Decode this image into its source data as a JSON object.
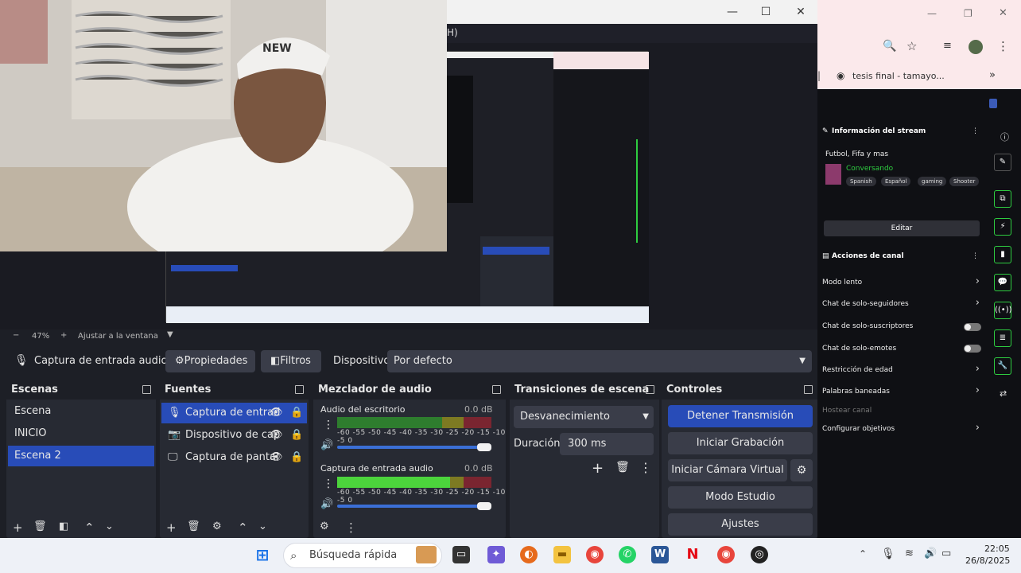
{
  "obs": {
    "title_fragment": "H)",
    "zoom": {
      "minus": "−",
      "percent": "47%",
      "plus": "+",
      "fit_label": "Ajustar a la ventana"
    },
    "source_bar": {
      "source_name": "Captura de entrada audio",
      "properties_label": "Propiedades",
      "filters_label": "Filtros",
      "device_label": "Dispositivo",
      "device_value": "Por defecto"
    },
    "scenes": {
      "title": "Escenas",
      "items": [
        "Escena",
        "INICIO",
        "Escena 2"
      ]
    },
    "sources": {
      "title": "Fuentes",
      "items": [
        "Captura de entrad",
        "Dispositivo de cap",
        "Captura de pantal"
      ]
    },
    "mixer": {
      "title": "Mezclador de audio",
      "channels": [
        {
          "name": "Audio del escritorio",
          "db": "0.0 dB",
          "level": 0
        },
        {
          "name": "Captura de entrada audio",
          "db": "0.0 dB",
          "level": 0.73
        }
      ],
      "ticks": "-60 -55 -50 -45 -40 -35 -30 -25 -20 -15 -10 -5  0"
    },
    "transitions": {
      "title": "Transiciones de escena",
      "type": "Desvanecimiento",
      "duration_label": "Duración",
      "duration_value": "300 ms"
    },
    "controls": {
      "title": "Controles",
      "stop_stream": "Detener Transmisión",
      "start_recording": "Iniciar Grabación",
      "virtual_cam": "Iniciar Cámara Virtual",
      "studio_mode": "Modo Estudio",
      "settings": "Ajustes"
    }
  },
  "chrome": {
    "bookmark": "tesis final - tamayo...",
    "stream_info_title": "Información del stream",
    "stream_title": "Futbol, Fifa y mas",
    "category": "Conversando",
    "tags": [
      "Spanish",
      "Español",
      "gaming",
      "Shooter"
    ],
    "edit_label": "Editar",
    "channel_actions_title": "Acciones de canal",
    "actions": [
      {
        "label": "Modo lento",
        "control": "chevron"
      },
      {
        "label": "Chat de solo-seguidores",
        "control": "chevron"
      },
      {
        "label": "Chat de solo-suscriptores",
        "control": "toggle"
      },
      {
        "label": "Chat de solo-emotes",
        "control": "toggle"
      },
      {
        "label": "Restricción de edad",
        "control": "chevron"
      },
      {
        "label": "Palabras baneadas",
        "control": "chevron"
      },
      {
        "label": "Hostear canal",
        "control": "none"
      },
      {
        "label": "Configurar objetivos",
        "control": "chevron"
      }
    ]
  },
  "taskbar": {
    "search_placeholder": "Búsqueda rápida",
    "time": "22:05",
    "date": "26/8/2025"
  },
  "colors": {
    "accent": "#284cb8",
    "twitch_green": "#2ecc40",
    "obs_bg": "#272a33"
  }
}
